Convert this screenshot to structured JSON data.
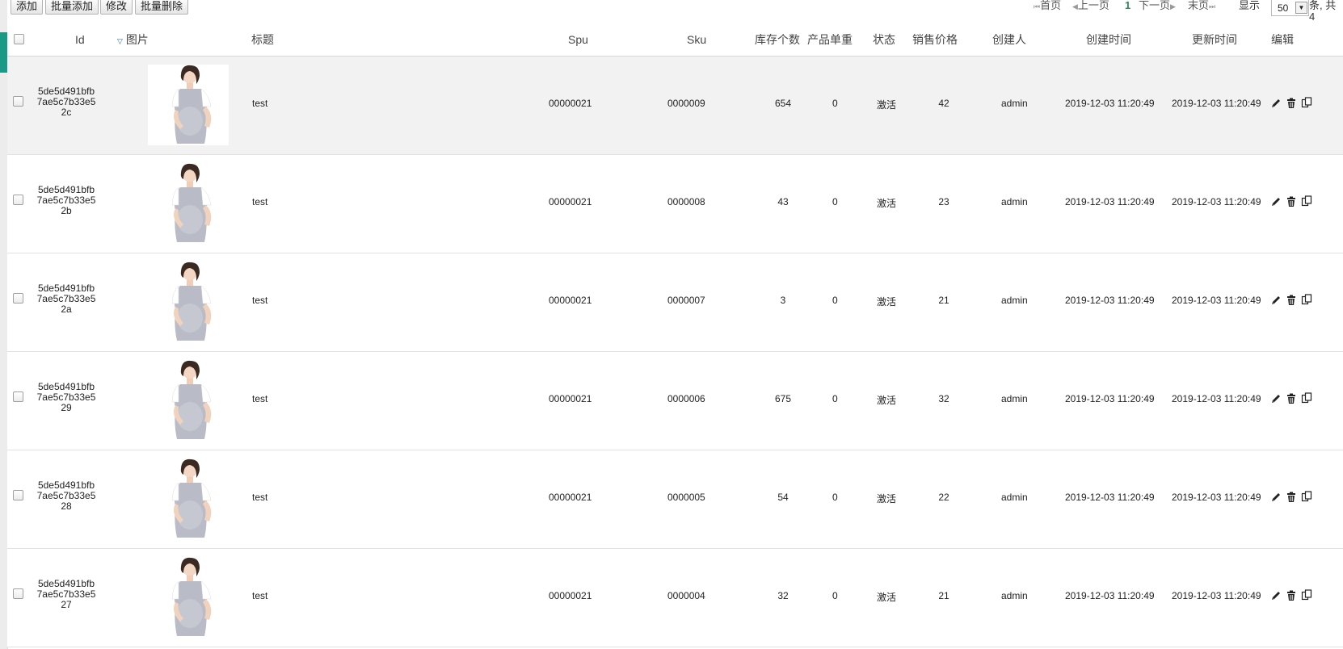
{
  "toolbar": {
    "add": "添加",
    "batch_add": "批量添加",
    "modify": "修改",
    "batch_delete": "批量删除"
  },
  "pager": {
    "first": "首页",
    "prev": "上一页",
    "current": "1",
    "next": "下一页",
    "last": "末页",
    "show_label": "显示",
    "page_size": "50",
    "total_text": "条, 共 4"
  },
  "columns": {
    "id": "Id",
    "image": "图片",
    "title": "标题",
    "spu": "Spu",
    "sku": "Sku",
    "stock": "库存个数",
    "weight": "产品单重",
    "status": "状态",
    "price": "销售价格",
    "creator": "创建人",
    "created": "创建时间",
    "updated": "更新时间",
    "edit": "编辑"
  },
  "rows": [
    {
      "id": "5de5d491bfb7ae5c7b33e52c",
      "title": "test",
      "spu": "00000021",
      "sku": "0000009",
      "stock": "654",
      "weight": "0",
      "status": "激活",
      "price": "42",
      "creator": "admin",
      "created": "2019-12-03 11:20:49",
      "updated": "2019-12-03 11:20:49"
    },
    {
      "id": "5de5d491bfb7ae5c7b33e52b",
      "title": "test",
      "spu": "00000021",
      "sku": "0000008",
      "stock": "43",
      "weight": "0",
      "status": "激活",
      "price": "23",
      "creator": "admin",
      "created": "2019-12-03 11:20:49",
      "updated": "2019-12-03 11:20:49"
    },
    {
      "id": "5de5d491bfb7ae5c7b33e52a",
      "title": "test",
      "spu": "00000021",
      "sku": "0000007",
      "stock": "3",
      "weight": "0",
      "status": "激活",
      "price": "21",
      "creator": "admin",
      "created": "2019-12-03 11:20:49",
      "updated": "2019-12-03 11:20:49"
    },
    {
      "id": "5de5d491bfb7ae5c7b33e529",
      "title": "test",
      "spu": "00000021",
      "sku": "0000006",
      "stock": "675",
      "weight": "0",
      "status": "激活",
      "price": "32",
      "creator": "admin",
      "created": "2019-12-03 11:20:49",
      "updated": "2019-12-03 11:20:49"
    },
    {
      "id": "5de5d491bfb7ae5c7b33e528",
      "title": "test",
      "spu": "00000021",
      "sku": "0000005",
      "stock": "54",
      "weight": "0",
      "status": "激活",
      "price": "22",
      "creator": "admin",
      "created": "2019-12-03 11:20:49",
      "updated": "2019-12-03 11:20:49"
    },
    {
      "id": "5de5d491bfb7ae5c7b33e527",
      "title": "test",
      "spu": "00000021",
      "sku": "0000004",
      "stock": "32",
      "weight": "0",
      "status": "激活",
      "price": "21",
      "creator": "admin",
      "created": "2019-12-03 11:20:49",
      "updated": "2019-12-03 11:20:49"
    }
  ],
  "colors": {
    "accent": "#1a9a86",
    "pager_current": "#2e8b57"
  },
  "icons": [
    "edit-icon",
    "delete-icon",
    "copy-icon",
    "sort-desc-icon",
    "first-page-icon",
    "prev-page-icon",
    "next-page-icon",
    "last-page-icon"
  ]
}
